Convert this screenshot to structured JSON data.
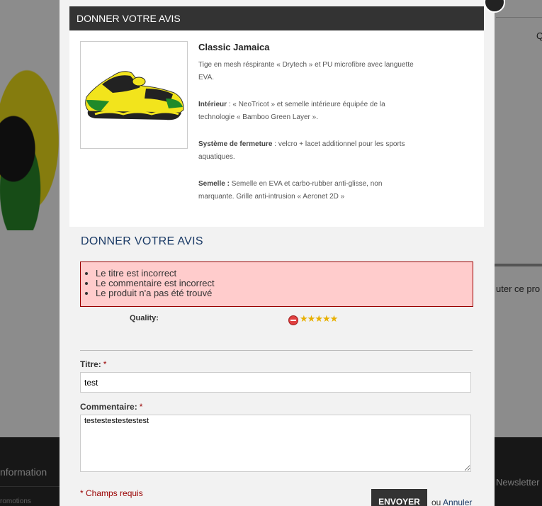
{
  "background": {
    "corner_text": "Q",
    "side_text": "uter ce pro",
    "footer_information": "nformation",
    "footer_promotions": "romotions",
    "footer_newsletter": "Newsletter"
  },
  "modal": {
    "header_title": "DONNER VOTRE AVIS",
    "product": {
      "image_icon": "shoe-image",
      "name": "Classic Jamaica",
      "description_intro": "Tige en mesh réspirante « Drytech » et PU microfibre avec languette EVA.",
      "features": [
        {
          "label": "Intérieur",
          "text": " : « NeoTricot » et semelle intérieure équipée de la technologie « Bamboo Green Layer »."
        },
        {
          "label": "Système de fermeture",
          "text": " : velcro + lacet additionnel pour les sports aquatiques."
        },
        {
          "label": "Semelle :",
          "text": " Semelle en EVA et carbo-rubber anti-glisse, non marquante. Grille anti-intrusion « Aeronet 2D »"
        }
      ]
    },
    "form": {
      "title": "DONNER VOTRE AVIS",
      "errors": [
        "Le titre est incorrect",
        "Le commentaire est incorrect",
        "Le produit n'a pas été trouvé"
      ],
      "quality_label": "Quality:",
      "rating": {
        "value": 5,
        "max": 5,
        "cancel_icon": "cancel-rating-icon",
        "star": "★"
      },
      "titre_label": "Titre:",
      "titre_value": "test",
      "comment_label": "Commentaire:",
      "comment_value": "testestestestestest",
      "required_marker": "*",
      "required_note": "* Champs requis",
      "submit_label": "ENVOYER",
      "or_text": "ou",
      "cancel_label": "Annuler"
    }
  },
  "colors": {
    "header_bg": "#333333",
    "form_title": "#1a3a66",
    "error_bg": "#ffcccc",
    "error_border": "#990000",
    "star": "#e8b000"
  }
}
